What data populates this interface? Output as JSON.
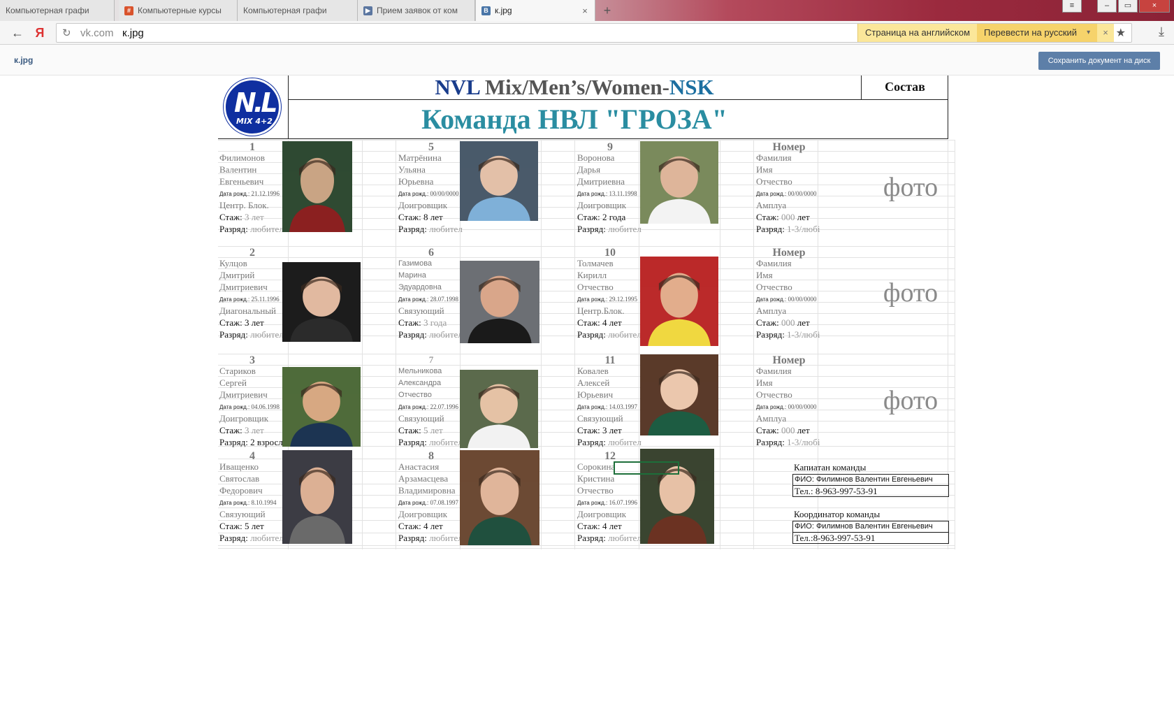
{
  "browser": {
    "tabs": [
      {
        "label": "Компьютерная графи",
        "icon": "document-icon"
      },
      {
        "label": "Компьютерные курсы",
        "icon": "hash-icon"
      },
      {
        "label": "Компьютерная графи",
        "icon": "document-icon"
      },
      {
        "label": "Прием заявок от ком",
        "icon": "play-icon"
      },
      {
        "label": "к.jpg",
        "icon": "vk-icon",
        "close": "×"
      }
    ],
    "newtab": "+",
    "window_buttons": {
      "menu": "≡",
      "minimize": "–",
      "restore": "▭",
      "close": "×"
    },
    "nav": {
      "back": "←",
      "yandex": "Я",
      "reload": "↻"
    },
    "address": {
      "host": "vk.com",
      "path": "к.jpg"
    },
    "translate": {
      "page_lang": "Страница на английском",
      "action": "Перевести на русский",
      "arrow": "▾",
      "close": "×"
    },
    "star": "★",
    "download": "⤓"
  },
  "viewer": {
    "filename": "к.jpg",
    "save_button": "Сохранить документ на диск"
  },
  "document": {
    "logo": {
      "big": "N.L",
      "small": "MIX 4+2"
    },
    "title_nvl": "NVL",
    "title_mid": " Mix/Men’s/Women-",
    "title_nsk": "NSK",
    "subtitle": "Команда НВЛ \"ГРОЗА\"",
    "sostav": "Состав",
    "players": [
      {
        "num": "1",
        "last": "Филимонов",
        "first": "Валентин",
        "patronymic": "Евгеньевич",
        "dob_label": "Дата рожд.:",
        "dob": "21.12.1996",
        "role": "Центр. Блок.",
        "exp_label": "Стаж:",
        "exp": "3 лет",
        "rank_label": "Разряд:",
        "rank": "любител"
      },
      {
        "num": "2",
        "last": "Кулцов",
        "first": "Дмитрий",
        "patronymic": "Дмитриевич",
        "dob_label": "Дата рожд.:",
        "dob": "25.11.1996",
        "role": "Диагональный",
        "exp_label": "Стаж:",
        "exp": "3 лет",
        "rank_label": "Разряд:",
        "rank": "любител"
      },
      {
        "num": "3",
        "last": "Стариков",
        "first": "Сергей",
        "patronymic": "Дмитриевич",
        "dob_label": "Дата рожд.:",
        "dob": "04.06.1998",
        "role": "Доигровщик",
        "exp_label": "Стаж:",
        "exp": "3 лет",
        "rank_label": "Разряд:",
        "rank": "2 взросл"
      },
      {
        "num": "4",
        "last": "Иващенко",
        "first": "Святослав",
        "patronymic": "Федорович",
        "dob_label": "Дата рожд.:",
        "dob": "8.10.1994",
        "role": "Связующий",
        "exp_label": "Стаж:",
        "exp": "5 лет",
        "rank_label": "Разряд:",
        "rank": "любител"
      },
      {
        "num": "5",
        "last": "Матрёнина",
        "first": "Ульяна",
        "patronymic": "Юрьевна",
        "dob_label": "Дата рожд.:",
        "dob": "00/00/0000",
        "role": "Доигровщик",
        "exp_label": "Стаж:",
        "exp": "8 лет",
        "rank_label": "Разряд:",
        "rank": "любител"
      },
      {
        "num": "6",
        "last": "Газимова",
        "first": "Марина",
        "patronymic": "Эдуардовна",
        "dob_label": "Дата рожд.:",
        "dob": "28.07.1998",
        "role": "Связующий",
        "exp_label": "Стаж:",
        "exp": "3 года",
        "rank_label": "Разряд:",
        "rank": "любитель"
      },
      {
        "num": "7",
        "last": "Мельникова",
        "first": "Александра",
        "patronymic": "Отчество",
        "dob_label": "Дата рожд.:",
        "dob": "22.07.1996",
        "role": "Связующий",
        "exp_label": "Стаж:",
        "exp": "5 лет",
        "rank_label": "Разряд:",
        "rank": "любитель"
      },
      {
        "num": "8",
        "last": "Анастасия",
        "first": "Арзамасцева",
        "patronymic": "Владимировна",
        "dob_label": "Дата рожд.:",
        "dob": "07.08.1997",
        "role": "Доигровщик",
        "exp_label": "Стаж:",
        "exp": "4 лет",
        "rank_label": "Разряд:",
        "rank": "любител"
      },
      {
        "num": "9",
        "last": "Воронова",
        "first": "Дарья",
        "patronymic": "Дмитриевна",
        "dob_label": "Дата рожд.:",
        "dob": "13.11.1998",
        "role": "Доигровщик",
        "exp_label": "Стаж:",
        "exp": "2 года",
        "rank_label": "Разряд:",
        "rank": "любител"
      },
      {
        "num": "10",
        "last": "Толмачев",
        "first": "Кирилл",
        "patronymic": "Отчество",
        "dob_label": "Дата рожд.:",
        "dob": "29.12.1995",
        "role": "Центр.Блок.",
        "exp_label": "Стаж:",
        "exp": "4 лет",
        "rank_label": "Разряд:",
        "rank": "любител"
      },
      {
        "num": "11",
        "last": "Ковалев",
        "first": "Алексей",
        "patronymic": "Юрьевич",
        "dob_label": "Дата рожд.:",
        "dob": "14.03.1997",
        "role": "Связующий",
        "exp_label": "Стаж:",
        "exp": "3 лет",
        "rank_label": "Разряд:",
        "rank": "любител"
      },
      {
        "num": "12",
        "last": "Сорокина",
        "first": "Кристина",
        "patronymic": "Отчество",
        "dob_label": "Дата рожд.:",
        "dob": "16.07.1996",
        "role": "Доигровщик",
        "exp_label": "Стаж:",
        "exp": "4 лет",
        "rank_label": "Разряд:",
        "rank": "любител"
      }
    ],
    "template_slot": {
      "num": "Номер",
      "last": "Фамилия",
      "first": "Имя",
      "patronymic": "Отчество",
      "dob_label": "Дата рожд.:",
      "dob": "00/00/0000",
      "role": "Амплуа",
      "exp_label": "Стаж:",
      "exp_value": "000",
      "exp_unit": "лет",
      "rank_label": "Разряд:",
      "rank": "1-3/любі",
      "photo": "фото"
    },
    "captain": {
      "title": "Капиатан команды",
      "fio": "ФИО: Филимнов Валентин Евгеньевич",
      "phone": "Тел.: 8-963-997-53-91"
    },
    "coordinator": {
      "title": "Координатор команды",
      "fio": "ФИО: Филимнов Валентин Евгеньевич",
      "phone": "Тел.:8-963-997-53-91"
    }
  }
}
